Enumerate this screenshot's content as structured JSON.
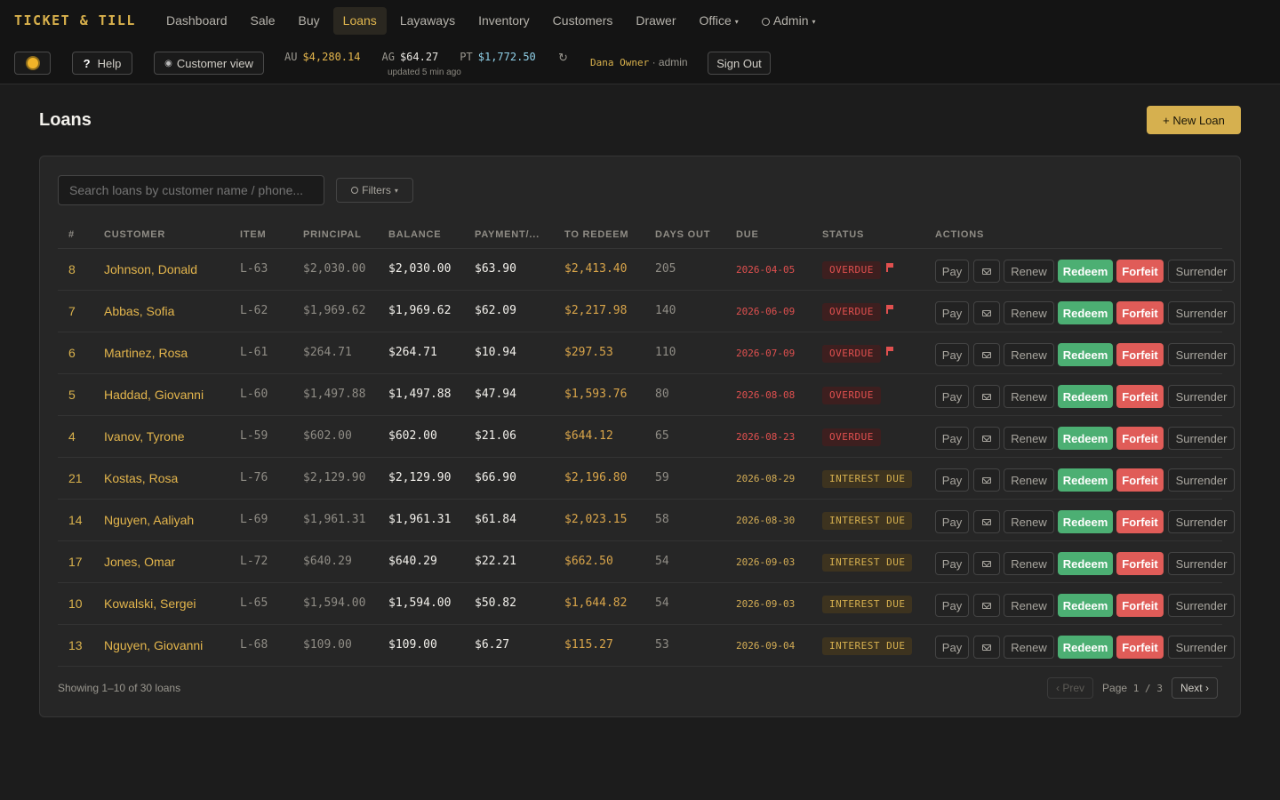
{
  "brand": "TICKET & TILL",
  "nav": [
    {
      "label": "Dashboard"
    },
    {
      "label": "Sale"
    },
    {
      "label": "Buy"
    },
    {
      "label": "Loans",
      "active": true
    },
    {
      "label": "Layaways"
    },
    {
      "label": "Inventory"
    },
    {
      "label": "Customers"
    },
    {
      "label": "Drawer"
    },
    {
      "label": "Office"
    },
    {
      "label": "Admin"
    }
  ],
  "toolbar": {
    "theme_icon": "sun-icon",
    "help_label": "Help",
    "customer_view_label": "Customer view",
    "metals": [
      {
        "symbol": "AU",
        "price": "$4,280.14",
        "color": "#e3b54c"
      },
      {
        "symbol": "AG",
        "price": "$64.27",
        "color": "#e8e6e1"
      },
      {
        "symbol": "PT",
        "price": "$1,772.50",
        "color": "#8fd0e8"
      }
    ],
    "updated": "updated 5 min ago",
    "user_name": "Dana Owner",
    "user_role": "· admin",
    "sign_out_label": "Sign Out"
  },
  "page": {
    "title": "Loans",
    "new_loan_label": "+ New Loan",
    "search_placeholder": "Search loans by customer name / phone...",
    "filters_label": "Filters"
  },
  "table": {
    "columns": [
      "#",
      "Customer",
      "Item",
      "Principal",
      "Balance",
      "Payment/...",
      "To Redeem",
      "Days Out",
      "Due",
      "Status",
      "Actions"
    ],
    "action_labels": {
      "pay": "Pay",
      "renew": "Renew",
      "redeem": "Redeem",
      "forfeit": "Forfeit",
      "surrender": "Surrender"
    },
    "rows": [
      {
        "num": "8",
        "customer": "Johnson, Donald",
        "item": "L-63",
        "principal": "$2,030.00",
        "balance": "$2,030.00",
        "payment": "$63.90",
        "redeem": "$2,413.40",
        "days": "205",
        "due": "2026-04-05",
        "status": "OVERDUE",
        "flag": true
      },
      {
        "num": "7",
        "customer": "Abbas, Sofia",
        "item": "L-62",
        "principal": "$1,969.62",
        "balance": "$1,969.62",
        "payment": "$62.09",
        "redeem": "$2,217.98",
        "days": "140",
        "due": "2026-06-09",
        "status": "OVERDUE",
        "flag": true
      },
      {
        "num": "6",
        "customer": "Martinez, Rosa",
        "item": "L-61",
        "principal": "$264.71",
        "balance": "$264.71",
        "payment": "$10.94",
        "redeem": "$297.53",
        "days": "110",
        "due": "2026-07-09",
        "status": "OVERDUE",
        "flag": true
      },
      {
        "num": "5",
        "customer": "Haddad, Giovanni",
        "item": "L-60",
        "principal": "$1,497.88",
        "balance": "$1,497.88",
        "payment": "$47.94",
        "redeem": "$1,593.76",
        "days": "80",
        "due": "2026-08-08",
        "status": "OVERDUE",
        "flag": false
      },
      {
        "num": "4",
        "customer": "Ivanov, Tyrone",
        "item": "L-59",
        "principal": "$602.00",
        "balance": "$602.00",
        "payment": "$21.06",
        "redeem": "$644.12",
        "days": "65",
        "due": "2026-08-23",
        "status": "OVERDUE",
        "flag": false
      },
      {
        "num": "21",
        "customer": "Kostas, Rosa",
        "item": "L-76",
        "principal": "$2,129.90",
        "balance": "$2,129.90",
        "payment": "$66.90",
        "redeem": "$2,196.80",
        "days": "59",
        "due": "2026-08-29",
        "status": "INTEREST DUE",
        "flag": false
      },
      {
        "num": "14",
        "customer": "Nguyen, Aaliyah",
        "item": "L-69",
        "principal": "$1,961.31",
        "balance": "$1,961.31",
        "payment": "$61.84",
        "redeem": "$2,023.15",
        "days": "58",
        "due": "2026-08-30",
        "status": "INTEREST DUE",
        "flag": false
      },
      {
        "num": "17",
        "customer": "Jones, Omar",
        "item": "L-72",
        "principal": "$640.29",
        "balance": "$640.29",
        "payment": "$22.21",
        "redeem": "$662.50",
        "days": "54",
        "due": "2026-09-03",
        "status": "INTEREST DUE",
        "flag": false
      },
      {
        "num": "10",
        "customer": "Kowalski, Sergei",
        "item": "L-65",
        "principal": "$1,594.00",
        "balance": "$1,594.00",
        "payment": "$50.82",
        "redeem": "$1,644.82",
        "days": "54",
        "due": "2026-09-03",
        "status": "INTEREST DUE",
        "flag": false
      },
      {
        "num": "13",
        "customer": "Nguyen, Giovanni",
        "item": "L-68",
        "principal": "$109.00",
        "balance": "$109.00",
        "payment": "$6.27",
        "redeem": "$115.27",
        "days": "53",
        "due": "2026-09-04",
        "status": "INTEREST DUE",
        "flag": false
      }
    ]
  },
  "footer": {
    "showing": "Showing 1–10 of 30 loans",
    "prev_label": "‹ Prev",
    "page_word": "Page",
    "page_current": "1",
    "page_sep": "/",
    "page_total": "3",
    "next_label": "Next ›"
  }
}
